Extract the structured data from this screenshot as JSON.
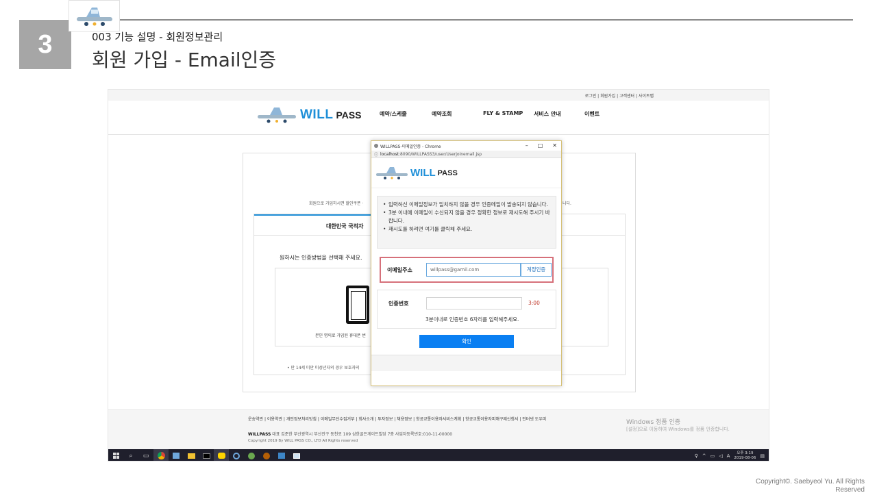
{
  "slide": {
    "number": "3",
    "subtitle": "003 기능 설명 - 회원정보관리",
    "title": "회원 가입 - Email인증",
    "copyright": "Copyright©. Saebyeol Yu. All Rights Reserved"
  },
  "site": {
    "util_links": "로그인 | 회원가입 | 고객센터 | 사이트맵",
    "logo_will": "WILL",
    "logo_pass": "PASS",
    "nav": [
      "예약/스케줄",
      "예약조회",
      "FLY & STAMP",
      "서비스 안내",
      "이벤트"
    ],
    "intro_text": "회원으로 가입하시면 할인쿠폰 ·",
    "intro_tail": "니다.",
    "tab_label": "대한민국 국적자",
    "choose_text": "원하시는 인증방법을 선택해 주세요.",
    "phone_caption": "본인 명의로 가입된 휴대폰 번",
    "under14": "•  만 14세 미만 미성년자의 경우 보호자의",
    "footer_links": "운송약관 | 이용약관 | 개인정보처리방침 | 이메일무단수집거부 | 회사소개 | 투자정보 | 채용정보 | 항공교통이용자서비스계획 | 항공교통이용자피해구제신청서 | 인터넷 도우미",
    "footer_brand": "WILLPASS",
    "footer_addr": " 대표 김준한 부산광역시 부산진구 동천로 109 삼한골든게이트빌딩 7층 사업자등록번호:010-11-00000",
    "footer_copy": "Copyright 2019 By WILL PASS CO., LTD All Rights reserved",
    "win_activate_title": "Windows 정품 인증",
    "win_activate_sub": "[설정]으로 이동하여 Windows를 정품 인증합니다."
  },
  "popup": {
    "window_title": "WILLPASS-이메일인증 - Chrome",
    "url_host": "localhost",
    "url_path": ":8090/WILLPASS3/user/Userjoinemail.jsp",
    "logo_will": "WILL",
    "logo_pass": "PASS",
    "notices": [
      "입력하신 이메일정보가 일치하지 않을 경우 인증메일이 발송되지 않습니다.",
      "3분 이내에 이메일이 수신되지 않을 경우 정확한 정보로 재시도해 주시기 바랍니다.",
      "재시도를 하려면 여기를 클릭해 주세요."
    ],
    "email_label": "이메일주소",
    "email_value": "willpass@gamil.com",
    "email_button": "계정인증",
    "code_label": "인증번호",
    "code_timer": "3:00",
    "code_help": "3분이내로 인증번호 6자리를 입력해주세요.",
    "confirm_button": "확인"
  },
  "taskbar": {
    "tray_lang": "A",
    "clock_time": "오후 3:19",
    "clock_date": "2019-08-06"
  },
  "colors": {
    "accent": "#1e8fd8",
    "confirm": "#0a7ff2",
    "highlight": "#d6707a"
  }
}
